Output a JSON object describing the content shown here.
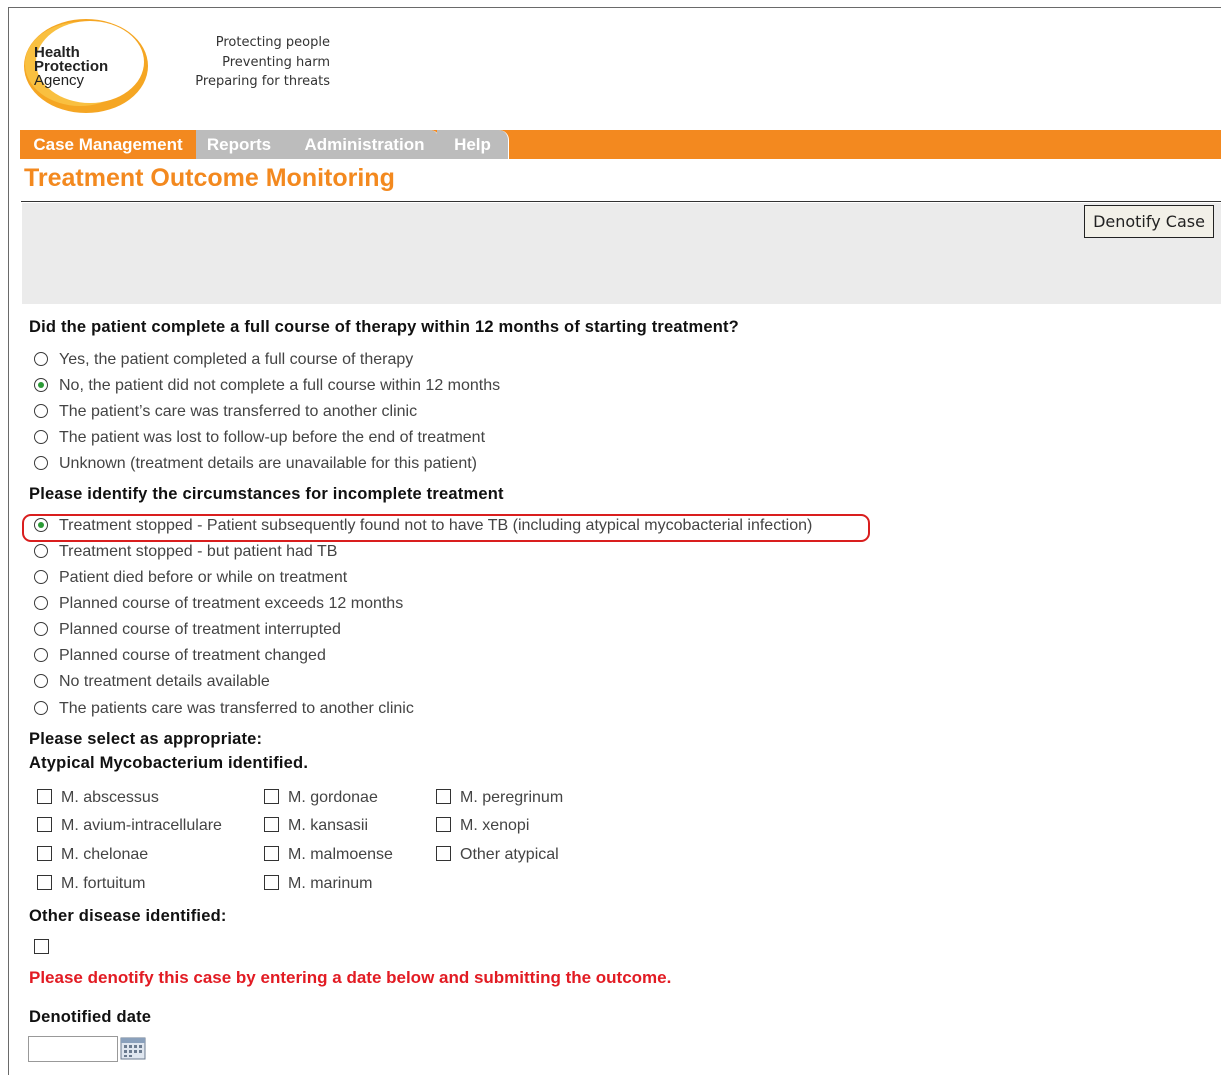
{
  "logo": {
    "line1": "Health",
    "line2": "Protection",
    "line3": "Agency"
  },
  "tagline": [
    "Protecting people",
    "Preventing harm",
    "Preparing for threats"
  ],
  "nav": {
    "tabs": [
      {
        "label": "Case Management",
        "active": true
      },
      {
        "label": "Reports",
        "active": false
      },
      {
        "label": "Administration",
        "active": false
      },
      {
        "label": "Help",
        "active": false
      }
    ]
  },
  "page_title": "Treatment Outcome Monitoring",
  "toolbar": {
    "denotify_label": "Denotify Case"
  },
  "q1": {
    "heading": "Did the patient complete a full course of therapy within 12 months of starting treatment?",
    "options": [
      {
        "label": "Yes, the patient completed a full course of therapy",
        "selected": false
      },
      {
        "label": "No, the patient did not complete a full course within 12 months",
        "selected": true
      },
      {
        "label": "The patient’s care was transferred to another clinic",
        "selected": false
      },
      {
        "label": "The patient was lost to follow-up before the end of treatment",
        "selected": false
      },
      {
        "label": "Unknown (treatment details are unavailable for this patient)",
        "selected": false
      }
    ]
  },
  "q2": {
    "heading": "Please identify the circumstances for incomplete treatment",
    "options": [
      {
        "label": "Treatment stopped - Patient subsequently found not to have TB (including atypical mycobacterial infection)",
        "selected": true
      },
      {
        "label": "Treatment stopped - but patient had TB",
        "selected": false
      },
      {
        "label": "Patient died before or while on treatment",
        "selected": false
      },
      {
        "label": "Planned course of treatment exceeds 12 months",
        "selected": false
      },
      {
        "label": "Planned course of treatment interrupted",
        "selected": false
      },
      {
        "label": "Planned course of treatment changed",
        "selected": false
      },
      {
        "label": "No treatment details available",
        "selected": false
      },
      {
        "label": "The patients care was transferred to another clinic",
        "selected": false
      }
    ]
  },
  "select_heading": "Please select as appropriate:",
  "atypical": {
    "heading": "Atypical Mycobacterium identified.",
    "col1": [
      "M. abscessus",
      "M. avium-intracellulare",
      "M. chelonae",
      "M. fortuitum"
    ],
    "col2": [
      "M. gordonae",
      "M. kansasii",
      "M. malmoense",
      "M. marinum"
    ],
    "col3": [
      "M. peregrinum",
      "M. xenopi",
      "Other atypical"
    ]
  },
  "other_disease": {
    "heading": "Other disease identified:",
    "checked": false
  },
  "warning": "Please denotify this case by entering a date below and submitting the outcome.",
  "denotified_date": {
    "label": "Denotified date",
    "value": ""
  },
  "colors": {
    "accent": "#f3891f",
    "warning": "#e21b23",
    "selected_radio": "#2a9a35"
  }
}
